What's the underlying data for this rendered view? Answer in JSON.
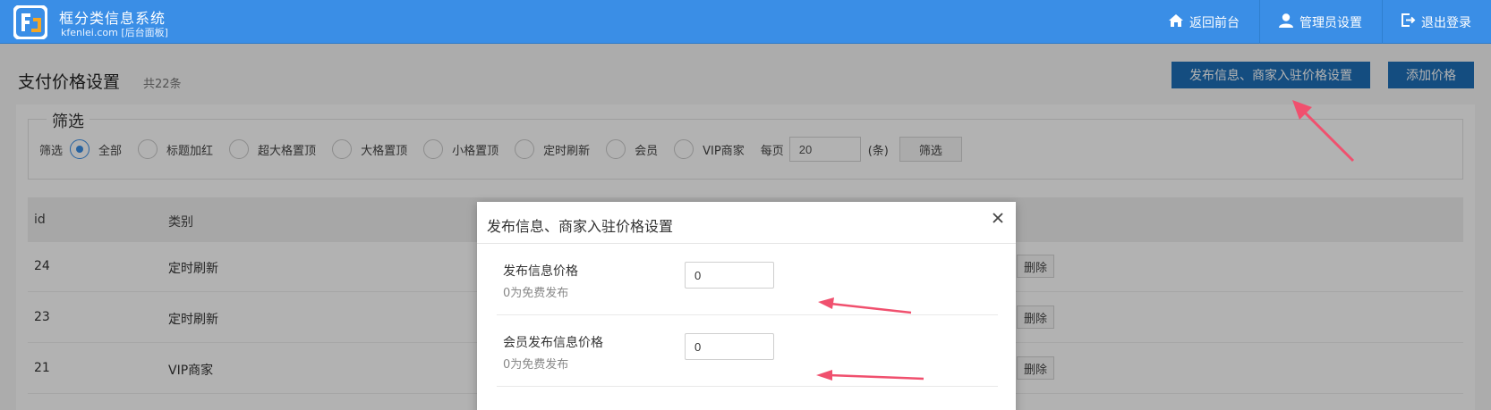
{
  "app": {
    "title": "框分类信息系统",
    "subtitle": "kfenlei.com [后台面板]"
  },
  "nav": {
    "items": [
      {
        "label": "返回前台",
        "icon": "home-icon"
      },
      {
        "label": "管理员设置",
        "icon": "user-icon"
      },
      {
        "label": "退出登录",
        "icon": "logout-icon"
      }
    ]
  },
  "page": {
    "title": "支付价格设置",
    "count": "共22条",
    "btn_price_settings": "发布信息、商家入驻价格设置",
    "btn_add": "添加价格"
  },
  "filter": {
    "legend": "筛选",
    "label": "筛选",
    "options": [
      "全部",
      "标题加红",
      "超大格置顶",
      "大格置顶",
      "小格置顶",
      "定时刷新",
      "会员",
      "VIP商家"
    ],
    "selected": "全部",
    "per_page_label": "每页",
    "per_page_value": "20",
    "unit": "(条)",
    "button": "筛选"
  },
  "table": {
    "headers": [
      "id",
      "类别"
    ],
    "rows": [
      {
        "id": "24",
        "category": "定时刷新",
        "action": "删除"
      },
      {
        "id": "23",
        "category": "定时刷新",
        "action": "删除"
      },
      {
        "id": "21",
        "category": "VIP商家",
        "action": "删除"
      }
    ]
  },
  "modal": {
    "title": "发布信息、商家入驻价格设置",
    "fields": [
      {
        "label": "发布信息价格",
        "help": "0为免费发布",
        "value": "0"
      },
      {
        "label": "会员发布信息价格",
        "help": "0为免费发布",
        "value": "0"
      }
    ]
  },
  "colors": {
    "header_bg": "#3a8ee6",
    "primary_button": "#1e6fb8",
    "annotation_arrow": "#f0506e"
  }
}
